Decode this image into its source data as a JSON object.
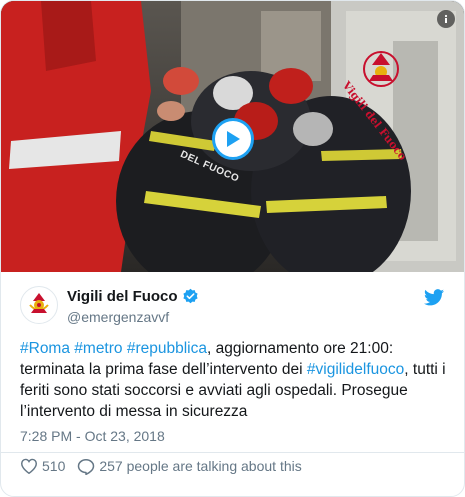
{
  "media": {
    "watermark_text": "Vigili del Fuoco",
    "helmet_text": "DEL FUOCO",
    "play_icon": "play-icon",
    "info_icon": "info-icon"
  },
  "author": {
    "name": "Vigili del Fuoco",
    "handle": "@emergenzavvf",
    "verified": true,
    "avatar_icon": "vigili-del-fuoco-logo-icon"
  },
  "tweet": {
    "parts": [
      {
        "text": "#Roma",
        "link": true
      },
      {
        "text": " ",
        "link": false
      },
      {
        "text": "#metro",
        "link": true
      },
      {
        "text": " ",
        "link": false
      },
      {
        "text": "#repubblica",
        "link": true
      },
      {
        "text": ", aggiornamento ore 21:00: terminata la prima fase dell’intervento dei ",
        "link": false
      },
      {
        "text": "#vigilidelfuoco",
        "link": true
      },
      {
        "text": ", tutti i feriti sono stati soccorsi e avviati agli ospedali. Prosegue l’intervento di messa in sicurezza",
        "link": false
      }
    ],
    "timestamp": "7:28 PM - Oct 23, 2018"
  },
  "actions": {
    "likes": "510",
    "replies_text": "257 people are talking about this"
  },
  "colors": {
    "link": "#1b95e0",
    "secondary": "#657786",
    "twitter_blue": "#1da1f2",
    "logo_red": "#c8102e",
    "logo_gold": "#e8b00f"
  }
}
